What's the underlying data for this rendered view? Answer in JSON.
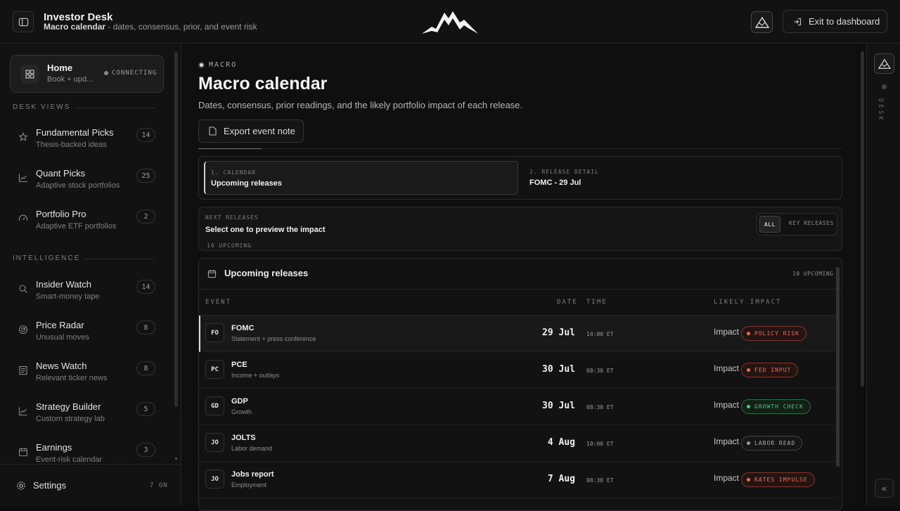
{
  "app": {
    "title": "Investor Desk",
    "subtitle_strong": "Macro calendar",
    "subtitle_rest": " - dates, consensus, prior, and event risk",
    "exit_label": "Exit to dashboard"
  },
  "sidebar": {
    "home": {
      "title": "Home",
      "sub": "Book + upd...",
      "status": "CONNECTING"
    },
    "desk_views_label": "DESK VIEWS",
    "desk_views": [
      {
        "label": "Fundamental Picks",
        "sub": "Thesis-backed ideas",
        "count": "14",
        "icon": "star-icon"
      },
      {
        "label": "Quant Picks",
        "sub": "Adaptive stock portfolios",
        "count": "25",
        "icon": "line-chart-icon"
      },
      {
        "label": "Portfolio Pro",
        "sub": "Adaptive ETF portfolios",
        "count": "2",
        "icon": "gauge-icon"
      }
    ],
    "intelligence_label": "INTELLIGENCE",
    "intelligence": [
      {
        "label": "Insider Watch",
        "sub": "Smart-money tape",
        "count": "14",
        "icon": "search-icon"
      },
      {
        "label": "Price Radar",
        "sub": "Unusual moves",
        "count": "8",
        "icon": "radar-icon"
      },
      {
        "label": "News Watch",
        "sub": "Relevant ticker news",
        "count": "8",
        "icon": "newspaper-icon"
      },
      {
        "label": "Strategy Builder",
        "sub": "Custom strategy lab",
        "count": "5",
        "icon": "line-chart-icon"
      },
      {
        "label": "Earnings",
        "sub": "Event-risk calendar",
        "count": "3",
        "icon": "calendar-icon"
      }
    ],
    "settings": {
      "label": "Settings",
      "status": "7 ON"
    }
  },
  "main": {
    "kicker": "MACRO",
    "title": "Macro calendar",
    "subtitle": "Dates, consensus, prior readings, and the likely portfolio impact of each release.",
    "export_label": "Export event note",
    "steps": [
      {
        "key": "1. CALENDAR",
        "value": "Upcoming releases"
      },
      {
        "key": "2. RELEASE DETAIL",
        "value": "FOMC - 29 Jul"
      }
    ],
    "next": {
      "key": "NEXT RELEASES",
      "value": "Select one to preview the impact",
      "count": "10 UPCOMING",
      "filters": [
        "ALL",
        "KEY RELEASES"
      ]
    },
    "table": {
      "title": "Upcoming releases",
      "count": "10 UPCOMING",
      "columns": [
        "EVENT",
        "DATE",
        "TIME",
        "LIKELY IMPACT"
      ],
      "rows": [
        {
          "abbr": "FO",
          "name": "FOMC",
          "sub": "Statement + press conference",
          "date": "29 Jul",
          "time": "14:00 ET",
          "impact": "Impact",
          "tag": "POLICY RISK",
          "tag_color": "#e0705f"
        },
        {
          "abbr": "PC",
          "name": "PCE",
          "sub": "Income + outlays",
          "date": "30 Jul",
          "time": "08:30 ET",
          "impact": "Impact",
          "tag": "FED INPUT",
          "tag_color": "#e0705f"
        },
        {
          "abbr": "GD",
          "name": "GDP",
          "sub": "Growth",
          "date": "30 Jul",
          "time": "08:30 ET",
          "impact": "Impact",
          "tag": "GROWTH CHECK",
          "tag_color": "#5fbf7f"
        },
        {
          "abbr": "JO",
          "name": "JOLTS",
          "sub": "Labor demand",
          "date": "4 Aug",
          "time": "10:00 ET",
          "impact": "Impact",
          "tag": "LABOR READ",
          "tag_color": "#9a9a9a"
        },
        {
          "abbr": "JO",
          "name": "Jobs report",
          "sub": "Employment",
          "date": "7 Aug",
          "time": "08:30 ET",
          "impact": "Impact",
          "tag": "RATES IMPULSE",
          "tag_color": "#e0705f"
        }
      ]
    }
  },
  "rail": {
    "label": "DESK"
  }
}
